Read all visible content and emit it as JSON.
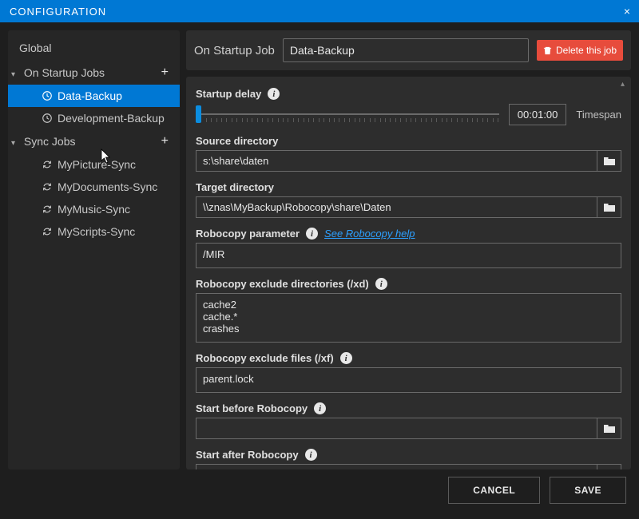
{
  "window": {
    "title": "CONFIGURATION",
    "close": "×"
  },
  "sidebar": {
    "root": "Global",
    "section1": {
      "label": "On Startup Jobs"
    },
    "section2": {
      "label": "Sync Jobs"
    },
    "startup_items": [
      {
        "label": "Data-Backup"
      },
      {
        "label": "Development-Backup"
      }
    ],
    "sync_items": [
      {
        "label": "MyPicture-Sync"
      },
      {
        "label": "MyDocuments-Sync"
      },
      {
        "label": "MyMusic-Sync"
      },
      {
        "label": "MyScripts-Sync"
      }
    ]
  },
  "header": {
    "label": "On Startup Job",
    "name": "Data-Backup",
    "delete": "Delete this job"
  },
  "form": {
    "startup_delay_label": "Startup delay",
    "timespan_value": "00:01:00",
    "timespan_label": "Timespan",
    "source_label": "Source directory",
    "source_value": "s:\\share\\daten",
    "target_label": "Target directory",
    "target_value": "\\\\znas\\MyBackup\\Robocopy\\share\\Daten",
    "param_label": "Robocopy parameter",
    "param_link": "See Robocopy help",
    "param_value": "/MIR",
    "xd_label": "Robocopy exclude directories (/xd)",
    "xd_value": "cache2\ncache.*\ncrashes",
    "xf_label": "Robocopy exclude files (/xf)",
    "xf_value": "parent.lock",
    "before_label": "Start before Robocopy",
    "before_value": "",
    "after_label": "Start after Robocopy",
    "after_value": ""
  },
  "footer": {
    "cancel": "CANCEL",
    "save": "SAVE"
  }
}
